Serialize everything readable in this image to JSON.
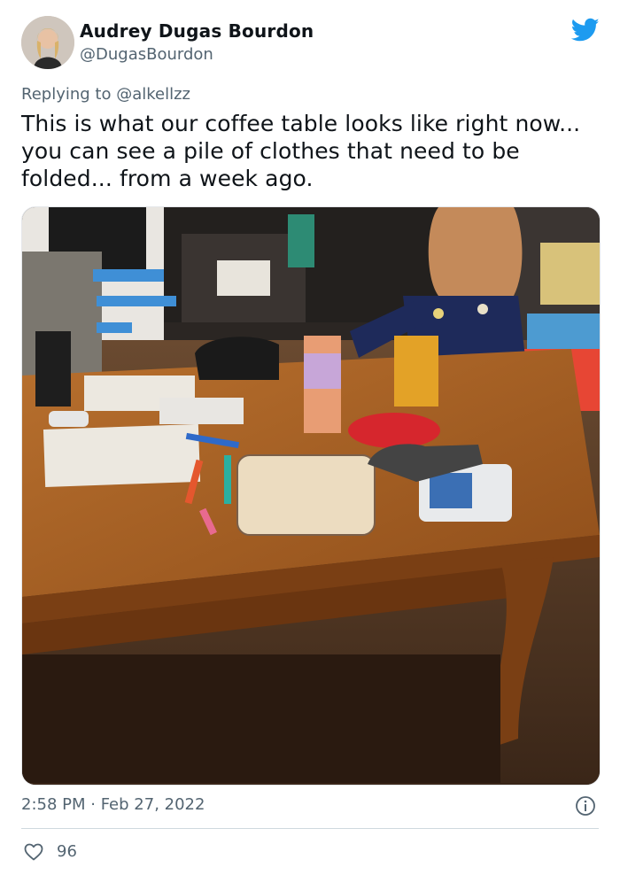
{
  "author": {
    "name": "Audrey Dugas Bourdon",
    "handle": "@DugasBourdon"
  },
  "reply": {
    "prefix": "Replying to ",
    "to": "@alkellzz"
  },
  "tweet": {
    "text": "This is what our coffee table looks like right now... you can see a pile of clothes that need to be folded... from a week ago."
  },
  "meta": {
    "timestamp": "2:58 PM · Feb 27, 2022",
    "likes": "96"
  },
  "icons": {
    "brand": "twitter-bird-icon",
    "info": "info-icon",
    "like": "heart-icon"
  },
  "colors": {
    "twitter_blue": "#1d9bf0",
    "secondary_text": "#536471"
  }
}
